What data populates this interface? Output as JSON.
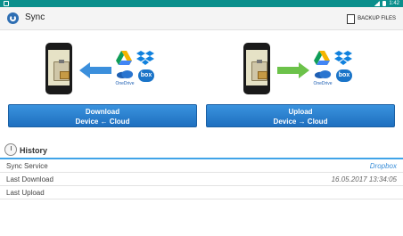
{
  "statusbar": {
    "time": "1:42"
  },
  "toolbar": {
    "title": "Sync",
    "backup_label": "BACKUP FILES"
  },
  "panels": {
    "download": {
      "line1": "Download",
      "line2": "Device ← Cloud"
    },
    "upload": {
      "line1": "Upload",
      "line2": "Device → Cloud"
    }
  },
  "services": {
    "onedrive": "OneDrive",
    "box": "box"
  },
  "history": {
    "title": "History",
    "rows": [
      {
        "label": "Sync Service",
        "value": "Dropbox"
      },
      {
        "label": "Last Download",
        "value": "16.05.2017 13:34:05"
      },
      {
        "label": "Last Upload",
        "value": ""
      }
    ]
  },
  "colors": {
    "statusbar": "#0a8f8c",
    "button": "#2a82cf",
    "accent_line": "#40a4e8",
    "arrow_left": "#3b8fdc",
    "arrow_right": "#6cc24a"
  }
}
